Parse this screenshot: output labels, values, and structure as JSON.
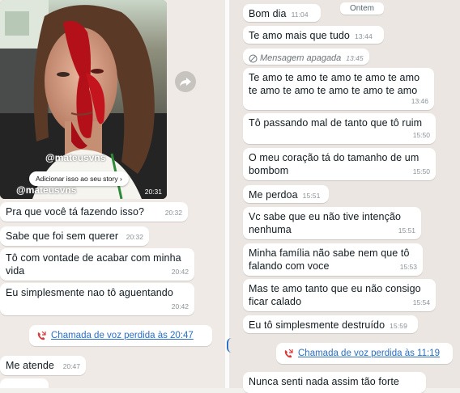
{
  "left_panel": {
    "photo": {
      "watermark": "@mateusvns",
      "watermark_bottom": "@mateusvns",
      "story_button_label": "Adicionar isso ao seu story",
      "time": "20:31"
    },
    "messages": [
      {
        "text": "Pra que você tá fazendo isso?",
        "time": "20:32"
      },
      {
        "text": "Sabe que foi sem querer",
        "time": "20:32"
      },
      {
        "text": "Tô com vontade de acabar com minha\nvida",
        "time": "20:42"
      },
      {
        "text": "Eu simplesmente nao tô aguentando",
        "time": "20:42"
      },
      {
        "text": "Me atende",
        "time": "20:47"
      }
    ],
    "missed_call": {
      "label": "Chamada de voz perdida às 20:47"
    }
  },
  "right_panel": {
    "date_chip": "Ontem",
    "messages": [
      {
        "text": "Bom dia",
        "time": "11:04"
      },
      {
        "text": "Te amo mais que tudo",
        "time": "13:44"
      },
      {
        "deleted_label": "Mensagem apagada",
        "time": "13:45"
      },
      {
        "text": "Te amo te amo te amo te amo te amo\nte amo te amo te amo te amo te amo",
        "time": "13:46"
      },
      {
        "text": "Tô passando mal de tanto que tô ruim",
        "time": "15:50"
      },
      {
        "text": "O meu coração tá do tamanho de um\nbombom",
        "time": "15:50"
      },
      {
        "text": "Me perdoa",
        "time": "15:51"
      },
      {
        "text": "Vc sabe que eu não tive intenção\nnenhuma",
        "time": "15:51"
      },
      {
        "text": "Minha família não sabe nem que tô\nfalando com voce",
        "time": "15:53"
      },
      {
        "text": "Mas te amo tanto que eu não consigo\nficar calado",
        "time": "15:54"
      },
      {
        "text": "Eu tô simplesmente destruído",
        "time": "15:59"
      },
      {
        "text": "Nunca senti nada assim tão forte"
      }
    ],
    "missed_call": {
      "label": "Chamada de voz perdida às 11:19"
    }
  },
  "colors": {
    "link": "#2c6fc4",
    "missed_call_icon": "#d93a3a",
    "bubble": "#ffffff"
  }
}
